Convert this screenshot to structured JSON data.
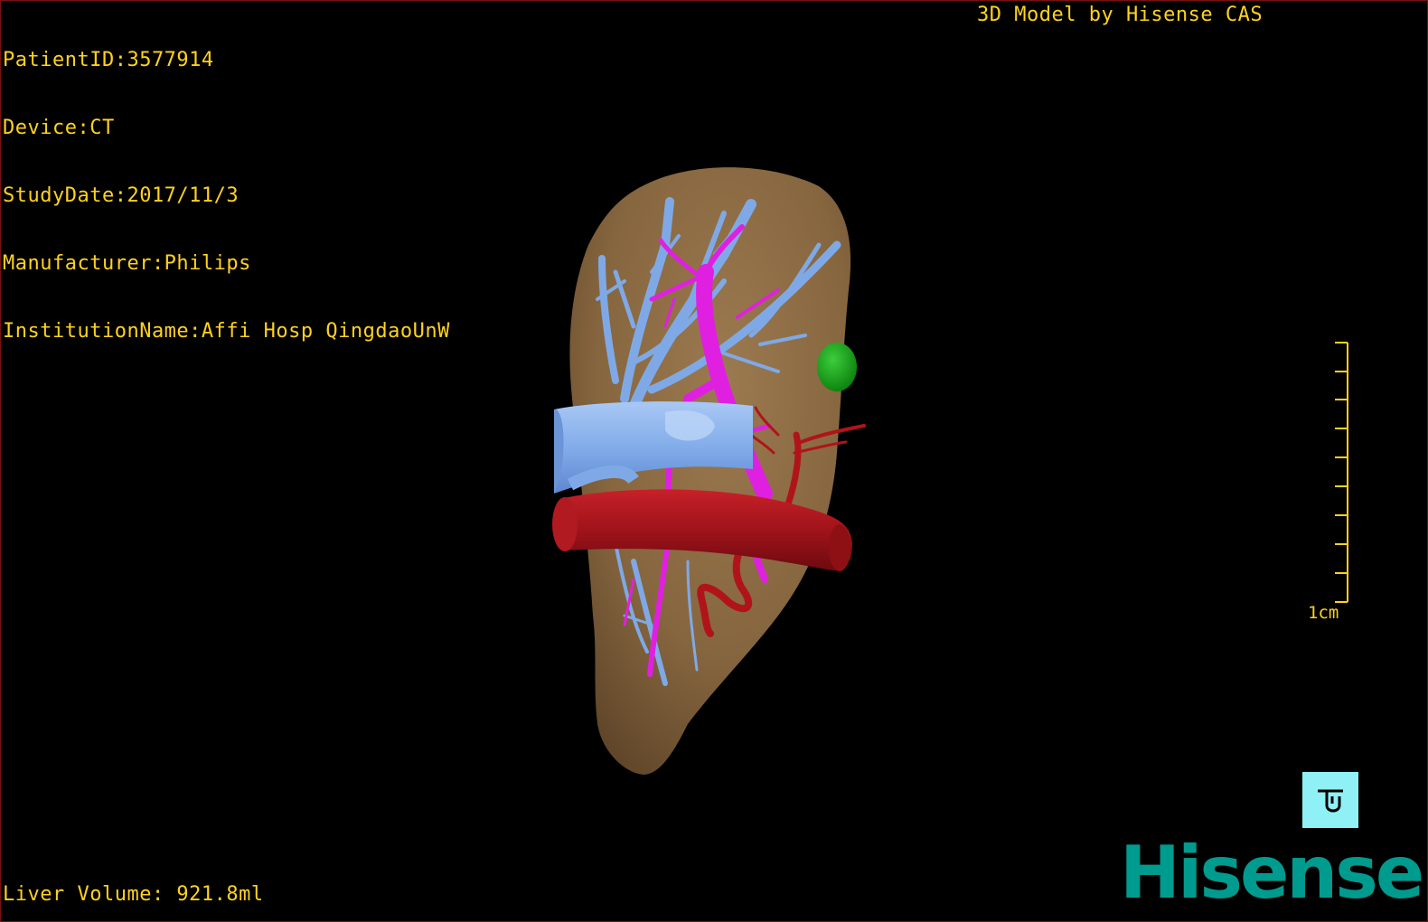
{
  "patient_info": {
    "patient_id": "PatientID:3577914",
    "device": "Device:CT",
    "study_date": "StudyDate:2017/11/3",
    "manufacturer": "Manufacturer:Philips",
    "institution": "InstitutionName:Affi Hosp QingdaoUnW"
  },
  "model_credit": "3D Model by Hisense CAS",
  "liver_volume": "Liver Volume: 921.8ml",
  "scale_bar": {
    "label": "1cm"
  },
  "reset_view_button": {
    "icon": "view-reset-icon"
  },
  "brand": {
    "logo_text": "Hisense"
  },
  "colors": {
    "overlay_text": "#ffd21f",
    "liver": "#8a6a43",
    "portal_vein": "#7fa9e6",
    "hepatic_vein": "#e020e0",
    "artery": "#b0141a",
    "nodule": "#1aa31a",
    "brand": "#009b8f",
    "button": "#8ff0f6"
  }
}
